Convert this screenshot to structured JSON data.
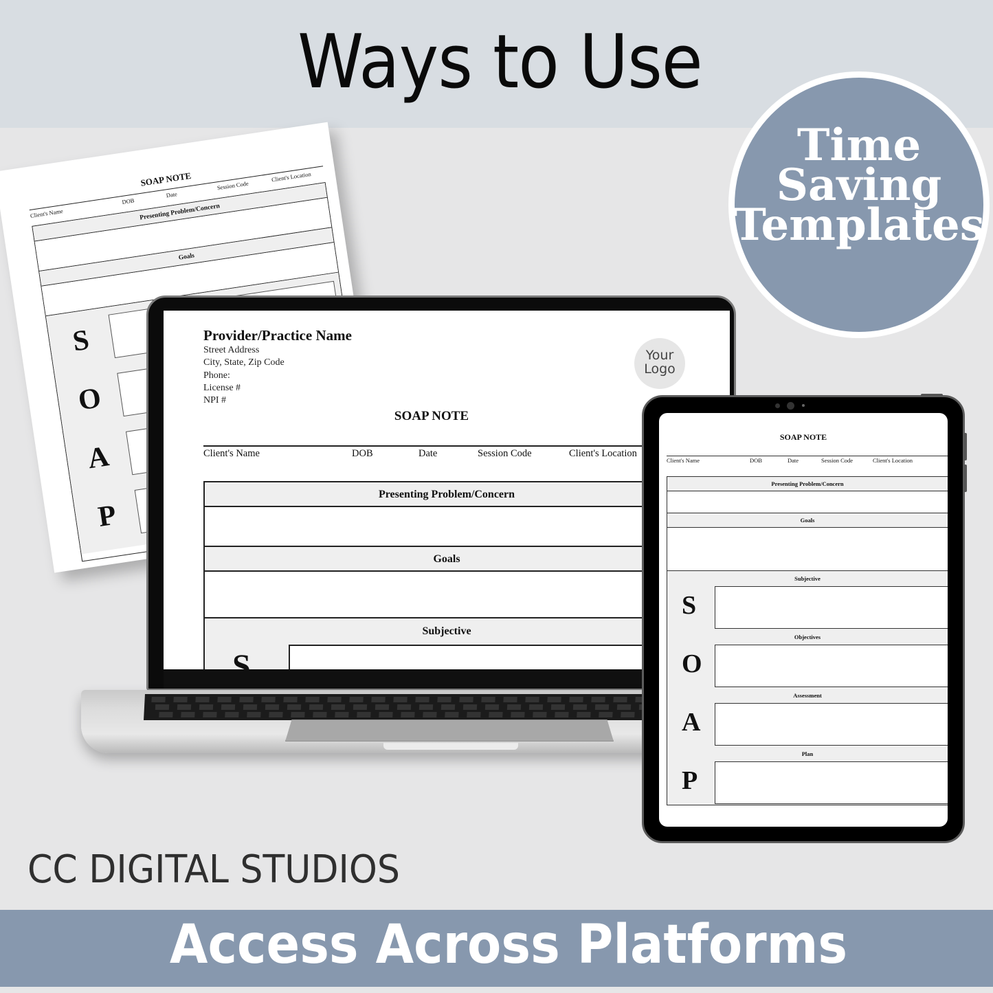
{
  "header": {
    "title": "Ways to Use"
  },
  "badge": {
    "lines": [
      "Time",
      "Saving",
      "Templates"
    ]
  },
  "colors": {
    "accent": "#8798ae",
    "top_band": "#d8dde2",
    "background": "#e6e6e7",
    "text_dark": "#0a0a0a"
  },
  "document": {
    "provider_name": "Provider/Practice Name",
    "address_lines": [
      "Street Address",
      "City, State, Zip Code",
      "Phone:",
      "License #",
      "NPI #"
    ],
    "logo_placeholder": [
      "Your",
      "Logo"
    ],
    "title": "SOAP NOTE",
    "fields": [
      "Client's Name",
      "DOB",
      "Date",
      "Session Code",
      "Client's Location"
    ],
    "sections": {
      "presenting": "Presenting Problem/Concern",
      "goals": "Goals",
      "subjective": "Subjective",
      "objectives": "Objectives",
      "assessment": "Assessment",
      "plan": "Plan"
    },
    "soap_letters": [
      "S",
      "O",
      "A",
      "P"
    ]
  },
  "footer": {
    "brand": "CC DIGITAL STUDIOS",
    "tagline": "Access Across Platforms"
  }
}
